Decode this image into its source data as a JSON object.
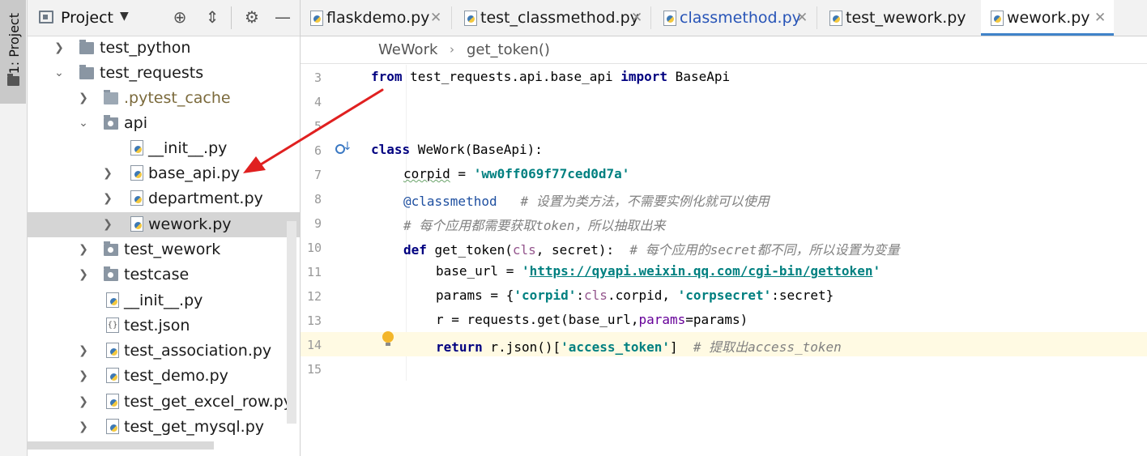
{
  "tool_strip": {
    "label": "1: Project"
  },
  "project_panel": {
    "title": "Project",
    "toolbar_icons": [
      "target-icon",
      "collapse-all-icon",
      "gear-icon",
      "hide-icon"
    ],
    "tree": [
      {
        "label": "test_python",
        "kind": "folder",
        "expanded": false
      },
      {
        "label": "test_requests",
        "kind": "folder",
        "expanded": true
      },
      {
        "label": ".pytest_cache",
        "kind": "folder-excluded",
        "expanded": false
      },
      {
        "label": "api",
        "kind": "package",
        "expanded": true
      },
      {
        "label": "__init__.py",
        "kind": "python-file"
      },
      {
        "label": "base_api.py",
        "kind": "python-file",
        "expandable": true
      },
      {
        "label": "department.py",
        "kind": "python-file",
        "expandable": true
      },
      {
        "label": "wework.py",
        "kind": "python-file",
        "expandable": true,
        "selected": true
      },
      {
        "label": "test_wework",
        "kind": "package",
        "expanded": false
      },
      {
        "label": "testcase",
        "kind": "package",
        "expanded": false
      },
      {
        "label": "__init__.py",
        "kind": "python-file"
      },
      {
        "label": "test.json",
        "kind": "json-file"
      },
      {
        "label": "test_association.py",
        "kind": "python-file",
        "expandable": true
      },
      {
        "label": "test_demo.py",
        "kind": "python-file",
        "expandable": true
      },
      {
        "label": "test_get_excel_row.py",
        "kind": "python-file",
        "expandable": true
      },
      {
        "label": "test_get_mysql.py",
        "kind": "python-file",
        "expandable": true
      }
    ]
  },
  "editor": {
    "tabs": [
      {
        "label": "flaskdemo.py"
      },
      {
        "label": "test_classmethod.py"
      },
      {
        "label": "classmethod.py",
        "modified": true
      },
      {
        "label": "test_wework.py"
      },
      {
        "label": "wework.py",
        "active": true
      }
    ],
    "breadcrumb": [
      "WeWork",
      "get_token()"
    ],
    "lines": {
      "n3": "3",
      "n4": "4",
      "n5": "5",
      "n6": "6",
      "n7": "7",
      "n8": "8",
      "n9": "9",
      "n10": "10",
      "n11": "11",
      "n12": "12",
      "n13": "13",
      "n14": "14",
      "n15": "15"
    },
    "code": {
      "l3_from": "from",
      "l3_mod": " test_requests.api.base_api ",
      "l3_import": "import",
      "l3_name": " BaseApi",
      "l6_class": "class",
      "l6_rest": " WeWork(BaseApi):",
      "l7_var": "corpid",
      "l7_eq": " = ",
      "l7_str": "'ww0ff069f77ced0d7a'",
      "l8_dec": "@classmethod",
      "l8_cm": "   # 设置为类方法，不需要实例化就可以使用",
      "l9_cm": "# 每个应用都需要获取token，所以抽取出来",
      "l10_def": "def",
      "l10_a": " get_token(",
      "l10_cls": "cls",
      "l10_b": ", secret):  ",
      "l10_cm": "# 每个应用的secret都不同，所以设置为变量",
      "l11_a": "base_url = ",
      "l11_q1": "'",
      "l11_url": "https://qyapi.weixin.qq.com/cgi-bin/gettoken",
      "l11_q2": "'",
      "l12_a": "params = {",
      "l12_s1": "'corpid'",
      "l12_b": ":",
      "l12_cls": "cls",
      "l12_c": ".corpid, ",
      "l12_s2": "'corpsecret'",
      "l12_d": ":secret}",
      "l13_a": "r = requests.get(base_url,",
      "l13_kw": "params",
      "l13_b": "=params)",
      "l14_ret": "return",
      "l14_a": " r.json()[",
      "l14_str": "'access_token'",
      "l14_b": "]  ",
      "l14_cm": "# 提取出access_token"
    }
  },
  "colors": {
    "keyword": "#000080",
    "string": "#008080",
    "comment": "#808080",
    "selection": "#d5d5d5",
    "current_line": "#fffae3",
    "active_tab_underline": "#4083c9",
    "annotation_arrow": "#e02020"
  }
}
